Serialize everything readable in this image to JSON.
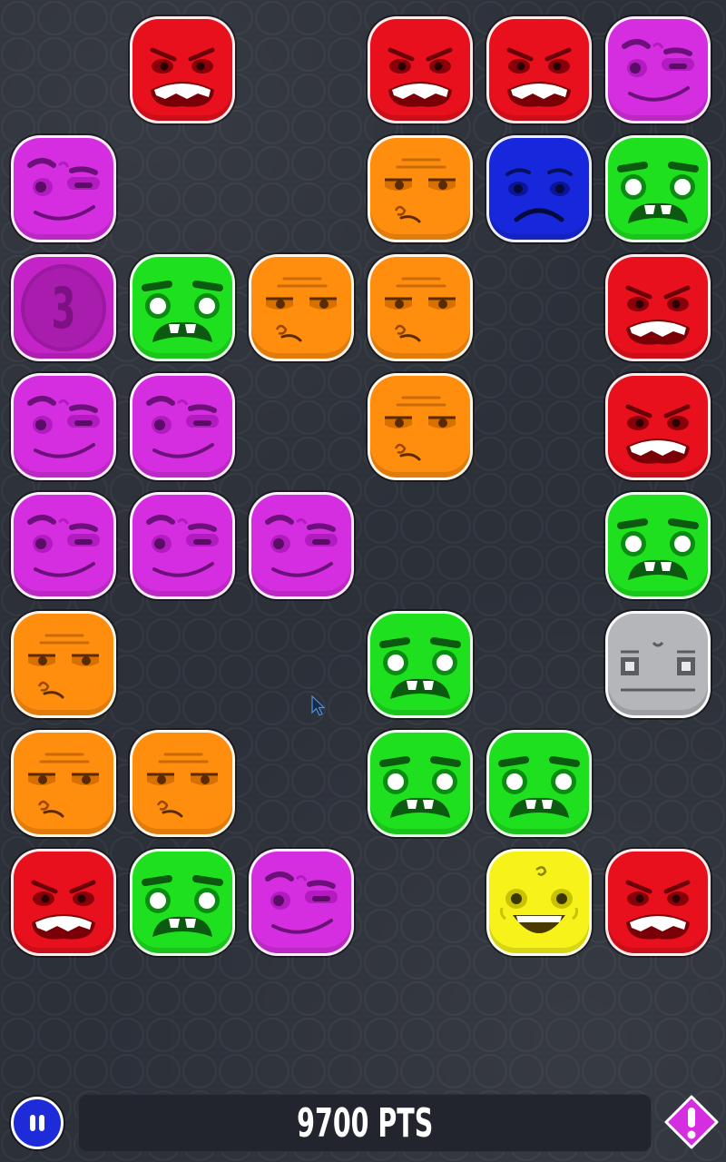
{
  "game": {
    "score_text": "9700 PTS",
    "bomb_count": "3",
    "colors": {
      "red": "#e8101c",
      "purple": "#d52ee0",
      "orange": "#ff8d0e",
      "blue": "#1727dc",
      "green": "#1ee01f",
      "gray": "#b4b6ba",
      "yellow": "#f6f21a",
      "background": "#2c3039",
      "pause_button": "#1d2bd8",
      "alert_button": "#d52ee0"
    },
    "grid_columns": 6,
    "grid_rows": 8,
    "board": [
      [
        "empty",
        "red",
        "empty",
        "red",
        "red",
        "purple"
      ],
      [
        "purple",
        "empty",
        "empty",
        "orange",
        "blue",
        "green"
      ],
      [
        "bomb",
        "green",
        "orange",
        "orange",
        "empty",
        "red"
      ],
      [
        "purple",
        "purple",
        "empty",
        "orange",
        "empty",
        "red"
      ],
      [
        "purple",
        "purple",
        "purple",
        "empty",
        "empty",
        "green"
      ],
      [
        "orange",
        "empty",
        "empty",
        "green",
        "empty",
        "gray"
      ],
      [
        "orange",
        "orange",
        "empty",
        "green",
        "green",
        "empty"
      ],
      [
        "red",
        "green",
        "purple",
        "empty",
        "yellow",
        "red"
      ]
    ],
    "face_types": {
      "red": "angry-face",
      "purple": "smirk-face",
      "orange": "bored-face",
      "blue": "sad-face",
      "green": "scared-face",
      "gray": "stone-face",
      "yellow": "happy-face",
      "bomb": "countdown-bomb"
    },
    "icons": {
      "pause": "pause-icon",
      "alert": "exclamation-icon",
      "cursor": "mouse-pointer-icon"
    }
  }
}
